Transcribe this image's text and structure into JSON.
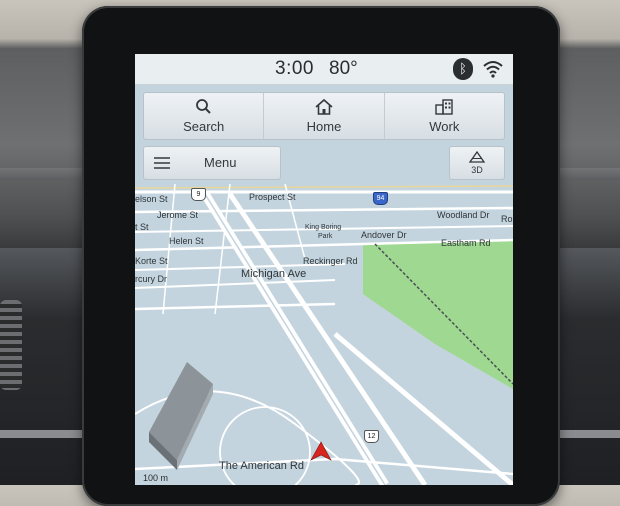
{
  "status_bar": {
    "time": "3:00",
    "temperature": "80°",
    "bluetooth_icon": "bluetooth-icon",
    "wifi_icon": "wifi-icon"
  },
  "quick_nav": [
    {
      "label": "Search",
      "icon": "search-icon"
    },
    {
      "label": "Home",
      "icon": "home-icon"
    },
    {
      "label": "Work",
      "icon": "work-icon"
    }
  ],
  "menu": {
    "label": "Menu",
    "icon": "hamburger-icon"
  },
  "view_toggle": {
    "label": "3D",
    "icon": "3d-view-icon"
  },
  "map": {
    "streets": {
      "nelson": "elson St",
      "jerome": "Jerome St",
      "st_fragment": "t St",
      "helen": "Helen St",
      "korte": "Korte St",
      "mercury": "rcury Dr",
      "prospect": "Prospect St",
      "king_boring_1": "King Boring",
      "king_boring_2": "Park",
      "andover": "Andover Dr",
      "woodland": "Woodland Dr",
      "ro": "Ro",
      "eastham": "Eastham Rd",
      "reckinger": "Reckinger Rd",
      "michigan": "Michigan Ave",
      "american": "The American Rd"
    },
    "shields": {
      "route_9": "9",
      "interstate_94": "94",
      "route_12": "12"
    },
    "scale": "100 m",
    "colors": {
      "water": "#c3d4de",
      "park": "#9fd890",
      "road": "#ffffff",
      "vehicle": "#d8241c"
    }
  }
}
